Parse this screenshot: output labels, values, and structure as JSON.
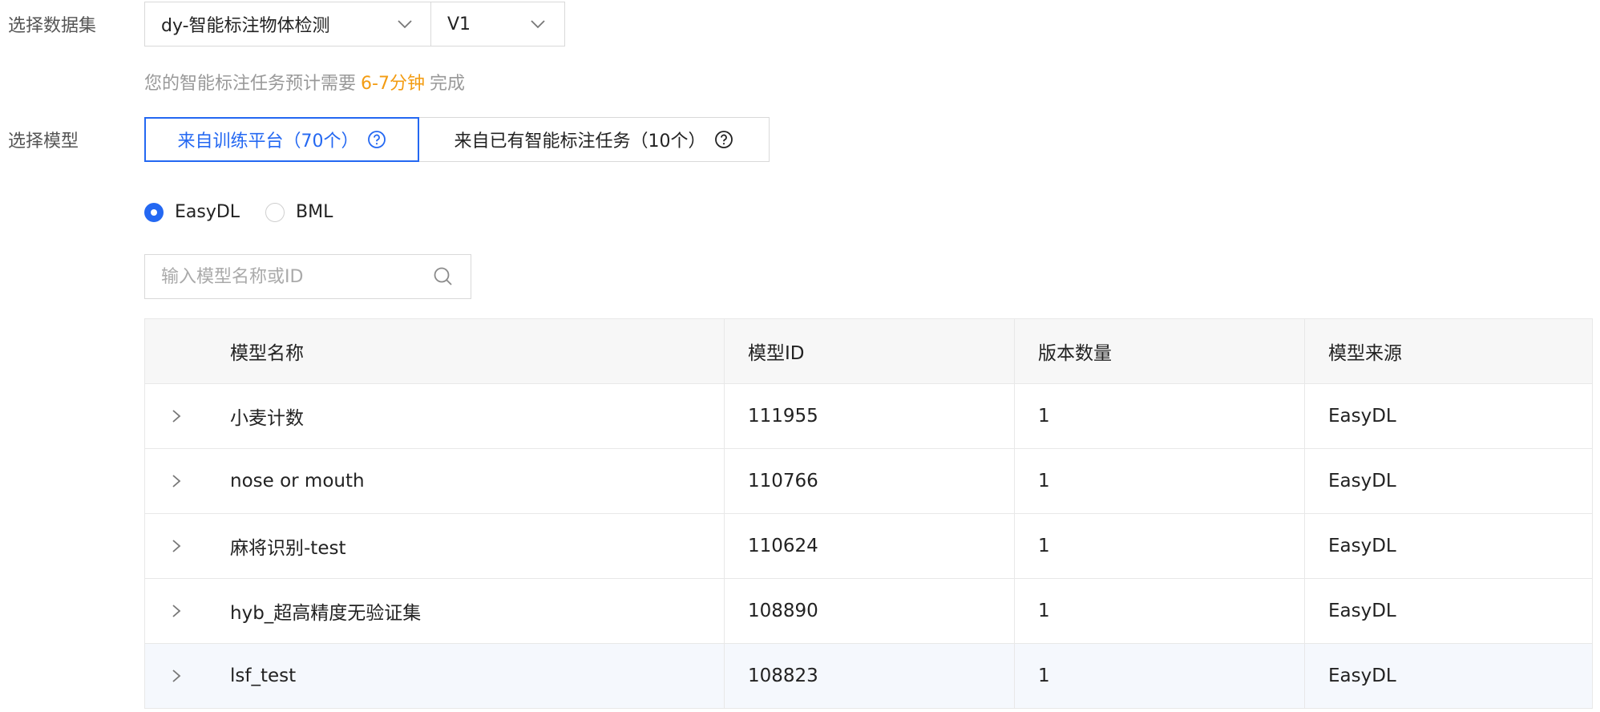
{
  "form": {
    "dataset_label": "选择数据集",
    "dataset_value": "dy-智能标注物体检测",
    "version_value": "V1",
    "hint_prefix": "您的智能标注任务预计需要",
    "hint_time": "6-7分钟",
    "hint_suffix": "完成",
    "model_label": "选择模型",
    "segments": [
      {
        "label": "来自训练平台（70个）",
        "active": true
      },
      {
        "label": "来自已有智能标注任务（10个）",
        "active": false
      }
    ],
    "radios": [
      {
        "label": "EasyDL",
        "checked": true
      },
      {
        "label": "BML",
        "checked": false
      }
    ],
    "search_placeholder": "输入模型名称或ID"
  },
  "table": {
    "headers": [
      "模型名称",
      "模型ID",
      "版本数量",
      "模型来源"
    ],
    "rows": [
      {
        "name": "小麦计数",
        "id": "111955",
        "versions": "1",
        "source": "EasyDL"
      },
      {
        "name": "nose or mouth",
        "id": "110766",
        "versions": "1",
        "source": "EasyDL"
      },
      {
        "name": "麻将识别-test",
        "id": "110624",
        "versions": "1",
        "source": "EasyDL"
      },
      {
        "name": "hyb_超高精度无验证集",
        "id": "108890",
        "versions": "1",
        "source": "EasyDL"
      },
      {
        "name": "lsf_test",
        "id": "108823",
        "versions": "1",
        "source": "EasyDL"
      }
    ]
  },
  "colors": {
    "accent": "#2468f2",
    "hint_accent": "#f39c12",
    "highlight_row": "#f5f8fd"
  },
  "icons": [
    "chevron-down-icon",
    "help-icon",
    "search-icon",
    "chevron-right-icon"
  ]
}
